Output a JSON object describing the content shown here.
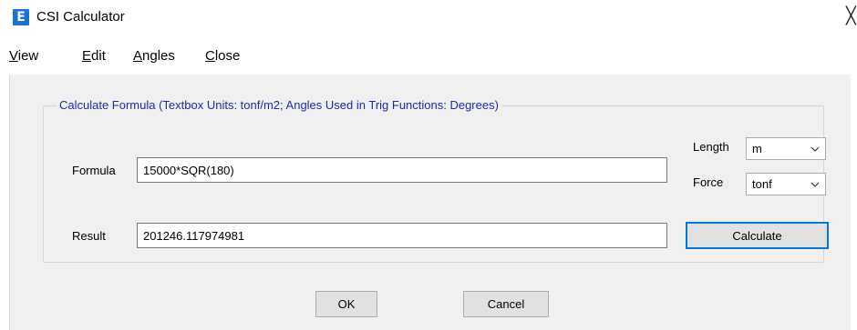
{
  "window": {
    "title": "CSI Calculator",
    "app_icon_letter": "E",
    "close_glyph": "╳"
  },
  "menu": {
    "items": [
      {
        "first": "V",
        "rest": "iew"
      },
      {
        "first": "E",
        "rest": "dit"
      },
      {
        "first": "A",
        "rest": "ngles"
      },
      {
        "first": "C",
        "rest": "lose"
      }
    ]
  },
  "group": {
    "caption": "Calculate Formula   (Textbox Units:  tonf/m2;   Angles Used in Trig Functions:  Degrees)"
  },
  "formula": {
    "label": "Formula",
    "value": "15000*SQR(180)"
  },
  "result": {
    "label": "Result",
    "value": "201246.117974981"
  },
  "units": {
    "length_label": "Length",
    "length_value": "m",
    "force_label": "Force",
    "force_value": "tonf"
  },
  "buttons": {
    "calculate": "Calculate",
    "ok": "OK",
    "cancel": "Cancel"
  },
  "icons": {
    "app": "app-logo-icon",
    "close": "close-icon",
    "dropdown": "chevron-down-icon"
  },
  "colors": {
    "app_icon": "#1873d3",
    "caption_text": "#1e2ba8",
    "default_button_border": "#0078d7"
  }
}
